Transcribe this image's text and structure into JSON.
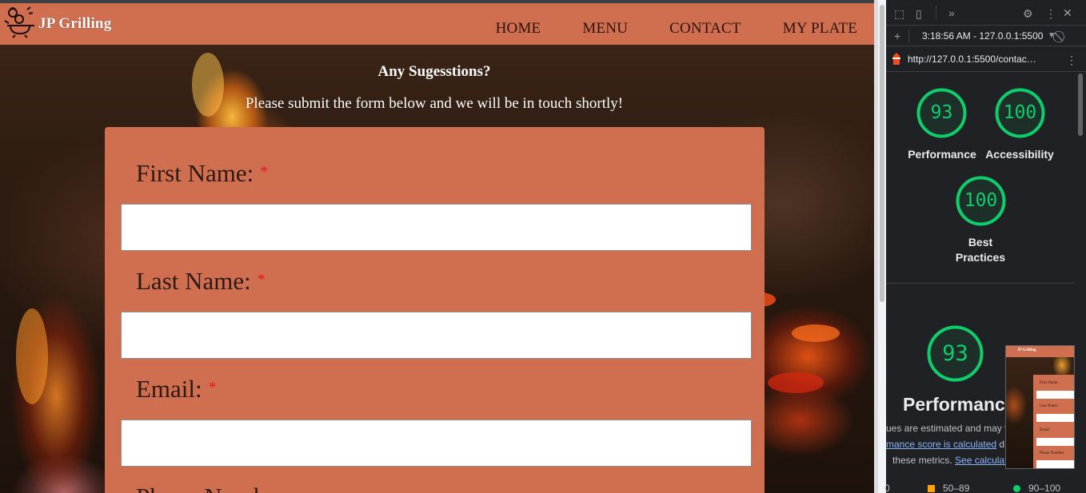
{
  "site": {
    "brand": "JP Grilling",
    "nav": [
      "HOME",
      "MENU",
      "CONTACT",
      "MY PLATE"
    ],
    "heading": "Any Sugesstions?",
    "subheading": "Please submit the form below and we will be in touch shortly!",
    "form": {
      "required_mark": "*",
      "fields": [
        {
          "label": "First Name:",
          "value": ""
        },
        {
          "label": "Last Name:",
          "value": ""
        },
        {
          "label": "Email:",
          "value": ""
        },
        {
          "label": "Phone Number",
          "value": ""
        }
      ]
    }
  },
  "devtools": {
    "timestamp": "3:18:56 AM - 127.0.0.1:5500",
    "url": "http://127.0.0.1:5500/contac…",
    "scores": [
      {
        "label": "Performance",
        "value": "93"
      },
      {
        "label": "Accessibility",
        "value": "100"
      },
      {
        "label": "Best Practices",
        "value": "100"
      }
    ],
    "best_line1": "Best",
    "best_line2": "Practices",
    "summary_score": "93",
    "summary_title": "Performance",
    "note_line1": "ues are estimated and may va",
    "note_link1": "mance score is calculated",
    "note_after1": " di",
    "note_line3": "these metrics.",
    "note_link2": "See calculat",
    "legend": [
      {
        "label": "50–89",
        "color": "#ffa400"
      },
      {
        "label": "90–100",
        "color": "#0cce6b"
      }
    ],
    "legend_fail_tail": "0",
    "thumbnail": {
      "brand": "JP Grilling",
      "labels": [
        "First Name: ",
        "Last Name: ",
        "Email: ",
        "Phone Number"
      ]
    },
    "colors": {
      "pass": "#0cce6b",
      "average": "#ffa400"
    }
  }
}
